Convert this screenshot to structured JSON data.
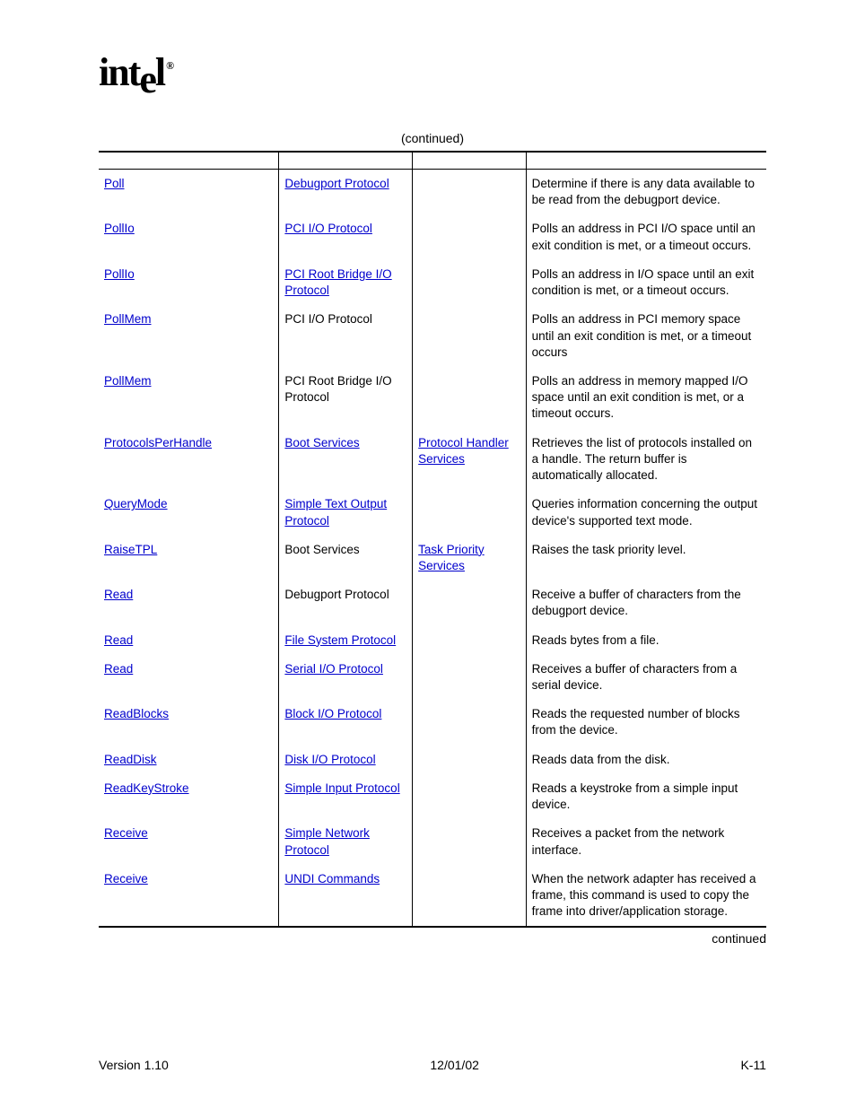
{
  "logo": {
    "prefix": "int",
    "drop": "e",
    "suffix": "l"
  },
  "continued_top": "(continued)",
  "rows": [
    {
      "fn": {
        "text": "Poll",
        "link": true
      },
      "svc": {
        "text": "Debugport Protocol",
        "link": true
      },
      "sub": {
        "text": "",
        "link": false
      },
      "desc": "Determine if there is any data available to be read from the debugport device."
    },
    {
      "fn": {
        "text": "PollIo",
        "link": true
      },
      "svc": {
        "text": "PCI I/O Protocol",
        "link": true
      },
      "sub": {
        "text": "",
        "link": false
      },
      "desc": "Polls an address in PCI I/O space until an exit condition is met, or a timeout occurs."
    },
    {
      "fn": {
        "text": "PollIo",
        "link": true
      },
      "svc": {
        "text": "PCI Root Bridge I/O Protocol",
        "link": true
      },
      "sub": {
        "text": "",
        "link": false
      },
      "desc": "Polls an address in I/O space until an exit condition is met, or a timeout occurs."
    },
    {
      "fn": {
        "text": "PollMem",
        "link": true
      },
      "svc": {
        "text": "PCI I/O Protocol",
        "link": false
      },
      "sub": {
        "text": "",
        "link": false
      },
      "desc": "Polls an address in PCI memory space until an exit condition is met, or a timeout occurs"
    },
    {
      "fn": {
        "text": "PollMem",
        "link": true
      },
      "svc": {
        "text": "PCI Root Bridge I/O Protocol",
        "link": false
      },
      "sub": {
        "text": "",
        "link": false
      },
      "desc": "Polls an address in memory mapped I/O space until an exit condition is met, or a timeout occurs."
    },
    {
      "fn": {
        "text": "ProtocolsPerHandle",
        "link": true
      },
      "svc": {
        "text": "Boot Services",
        "link": true
      },
      "sub": {
        "text": "Protocol Handler Services",
        "link": true
      },
      "desc": "Retrieves the list of protocols installed on a handle.  The return buffer is automatically allocated."
    },
    {
      "fn": {
        "text": "QueryMode",
        "link": true
      },
      "svc": {
        "text": "Simple Text Output Protocol",
        "link": true
      },
      "sub": {
        "text": "",
        "link": false
      },
      "desc": "Queries information concerning the output device's supported text mode."
    },
    {
      "fn": {
        "text": "RaiseTPL",
        "link": true
      },
      "svc": {
        "text": "Boot Services",
        "link": false
      },
      "sub": {
        "text": "Task Priority Services",
        "link": true
      },
      "desc": "Raises the task priority level."
    },
    {
      "fn": {
        "text": "Read",
        "link": true
      },
      "svc": {
        "text": "Debugport Protocol",
        "link": false
      },
      "sub": {
        "text": "",
        "link": false
      },
      "desc": "Receive a buffer of characters from the debugport device."
    },
    {
      "fn": {
        "text": "Read",
        "link": true
      },
      "svc": {
        "text": "File System Protocol",
        "link": true
      },
      "sub": {
        "text": "",
        "link": false
      },
      "desc": "Reads bytes from a file."
    },
    {
      "fn": {
        "text": "Read",
        "link": true
      },
      "svc": {
        "text": "Serial I/O Protocol",
        "link": true
      },
      "sub": {
        "text": "",
        "link": false
      },
      "desc": "Receives a buffer of characters from a serial device."
    },
    {
      "fn": {
        "text": "ReadBlocks",
        "link": true
      },
      "svc": {
        "text": "Block I/O Protocol",
        "link": true
      },
      "sub": {
        "text": "",
        "link": false
      },
      "desc": "Reads the requested number of blocks from the device."
    },
    {
      "fn": {
        "text": "ReadDisk",
        "link": true
      },
      "svc": {
        "text": "Disk I/O Protocol",
        "link": true
      },
      "sub": {
        "text": "",
        "link": false
      },
      "desc": "Reads data from the disk."
    },
    {
      "fn": {
        "text": "ReadKeyStroke",
        "link": true
      },
      "svc": {
        "text": "Simple Input Protocol",
        "link": true
      },
      "sub": {
        "text": "",
        "link": false
      },
      "desc": "Reads a keystroke from a simple input device."
    },
    {
      "fn": {
        "text": "Receive",
        "link": true
      },
      "svc": {
        "text": "Simple Network Protocol",
        "link": true
      },
      "sub": {
        "text": "",
        "link": false
      },
      "desc": "Receives a packet from the network interface."
    },
    {
      "fn": {
        "text": "Receive",
        "link": true
      },
      "svc": {
        "text": "UNDI Commands",
        "link": true
      },
      "sub": {
        "text": "",
        "link": false
      },
      "desc": "When the network adapter has received a frame, this command is used to copy the frame into driver/application storage."
    }
  ],
  "continued_bottom": "continued",
  "footer": {
    "left": "Version 1.10",
    "center": "12/01/02",
    "right": "K-11"
  }
}
